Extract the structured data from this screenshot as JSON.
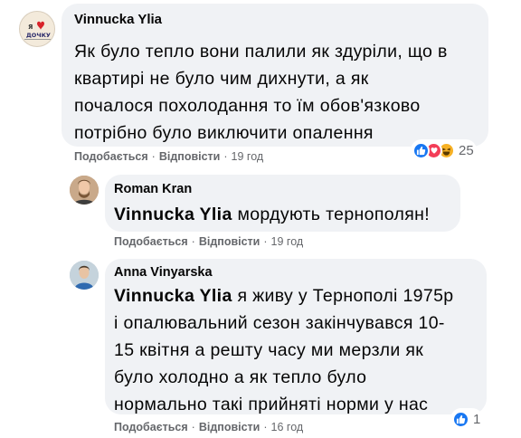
{
  "comments": [
    {
      "author": "Vinnucka Ylia",
      "avatar_name": "heart-logo-avatar",
      "avatar_text": "Я ДОЧКУ",
      "lines": [
        "Як було тепло вони палили як здуріли, що в",
        "квартирі не було чим дихнути, а як",
        "почалося похолодання то їм обов'язково",
        "потрібно було виключити опалення"
      ],
      "actions": {
        "like": "Подобається",
        "reply": "Відповісти",
        "time": "19 год"
      },
      "reactions": {
        "icons": [
          "like-icon",
          "love-icon",
          "haha-icon"
        ],
        "count": "25"
      }
    },
    {
      "author": "Roman Kran",
      "avatar_name": "roman-avatar",
      "mention": "Vinnucka Ylia",
      "lines": [
        "мордують тернополян!"
      ],
      "actions": {
        "like": "Подобається",
        "reply": "Відповісти",
        "time": "19 год"
      }
    },
    {
      "author": "Anna Vinyarska",
      "avatar_name": "anna-avatar",
      "mention": "Vinnucka Ylia",
      "lines": [
        "я живу у Тернополі 1975р",
        "і опалювальний сезон закінчувався 10-",
        "15 квітня а решту часу ми мерзли як",
        "було холодно а як тепло було",
        "нормально такі прийняті норми у нас"
      ],
      "actions": {
        "like": "Подобається",
        "reply": "Відповісти",
        "time": "16 год"
      },
      "reactions": {
        "icons": [
          "like-icon"
        ],
        "count": "1"
      }
    }
  ],
  "colors": {
    "bubble": "#f0f2f5",
    "meta": "#65676b",
    "text": "#050505",
    "like_blue": "#1877f2",
    "love_red": "#f33e58",
    "haha_yellow": "#f7b125"
  }
}
